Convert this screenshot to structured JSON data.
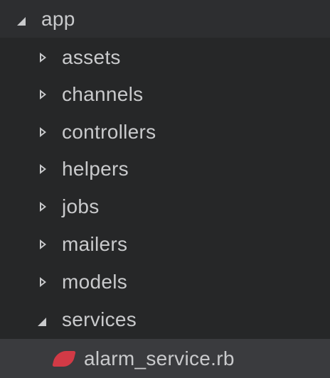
{
  "tree": {
    "root": {
      "label": "app",
      "state": "expanded"
    },
    "folders": [
      {
        "label": "assets",
        "state": "collapsed"
      },
      {
        "label": "channels",
        "state": "collapsed"
      },
      {
        "label": "controllers",
        "state": "collapsed"
      },
      {
        "label": "helpers",
        "state": "collapsed"
      },
      {
        "label": "jobs",
        "state": "collapsed"
      },
      {
        "label": "mailers",
        "state": "collapsed"
      },
      {
        "label": "models",
        "state": "collapsed"
      },
      {
        "label": "services",
        "state": "expanded"
      }
    ],
    "files": [
      {
        "label": "alarm_service.rb",
        "icon": "ruby-file-icon",
        "selected": true
      }
    ]
  },
  "colors": {
    "background": "#262728",
    "root_row": "#2d2e30",
    "selected_row": "#3a3b3e",
    "text": "#c9cacc",
    "ruby_icon": "#d23a46"
  }
}
